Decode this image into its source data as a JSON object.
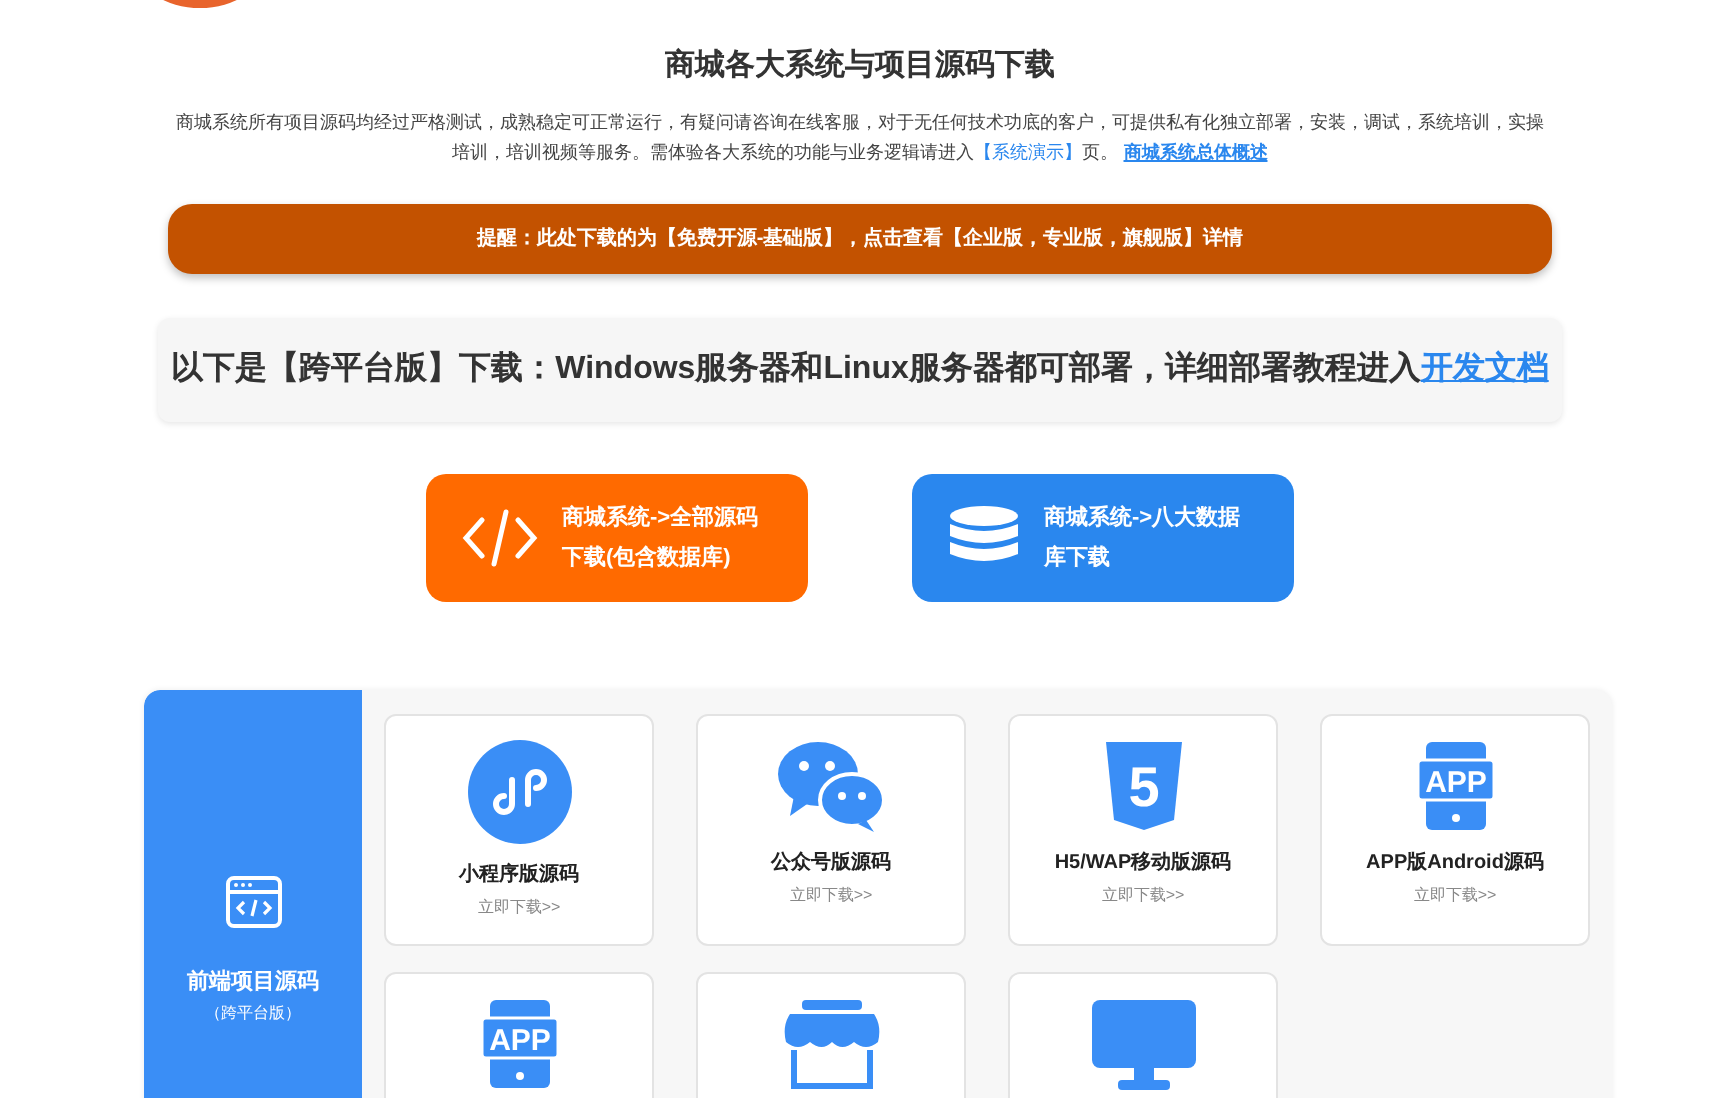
{
  "title": "商城各大系统与项目源码下载",
  "description": {
    "text": "商城系统所有项目源码均经过严格测试，成熟稳定可正常运行，有疑问请咨询在线客服，对于无任何技术功底的客户，可提供私有化独立部署，安装，调试，系统培训，实操培训，培训视频等服务。需体验各大系统的功能与业务逻辑请进入",
    "demo_link": "【系统演示】",
    "after": "页。",
    "overview_link": "商城系统总体概述"
  },
  "notice": "提醒：此处下载的为【免费开源-基础版】，点击查看【企业版，专业版，旗舰版】详情",
  "platform_bar": {
    "text": "以下是【跨平台版】下载：Windows服务器和Linux服务器都可部署，详细部署教程进入",
    "link": "开发文档"
  },
  "download_buttons": [
    {
      "kind": "code",
      "label": "商城系统->全部源码下载(包含数据库)",
      "color": "#ff6a00"
    },
    {
      "kind": "database",
      "label": "商城系统->八大数据库下载",
      "color": "#2a87ee"
    }
  ],
  "section": {
    "title": "前端项目源码",
    "subtitle": "（跨平台版）",
    "cards": [
      {
        "kind": "miniprogram",
        "title": "小程序版源码",
        "action": "立即下载>>"
      },
      {
        "kind": "chat",
        "title": "公众号版源码",
        "action": "立即下载>>"
      },
      {
        "kind": "html5",
        "icon_label": "5",
        "title": "H5/WAP移动版源码",
        "action": "立即下载>>"
      },
      {
        "kind": "app",
        "icon_label": "APP",
        "title": "APP版Android源码",
        "action": "立即下载>>"
      },
      {
        "kind": "app",
        "icon_label": "APP"
      },
      {
        "kind": "store"
      },
      {
        "kind": "monitor"
      }
    ]
  }
}
